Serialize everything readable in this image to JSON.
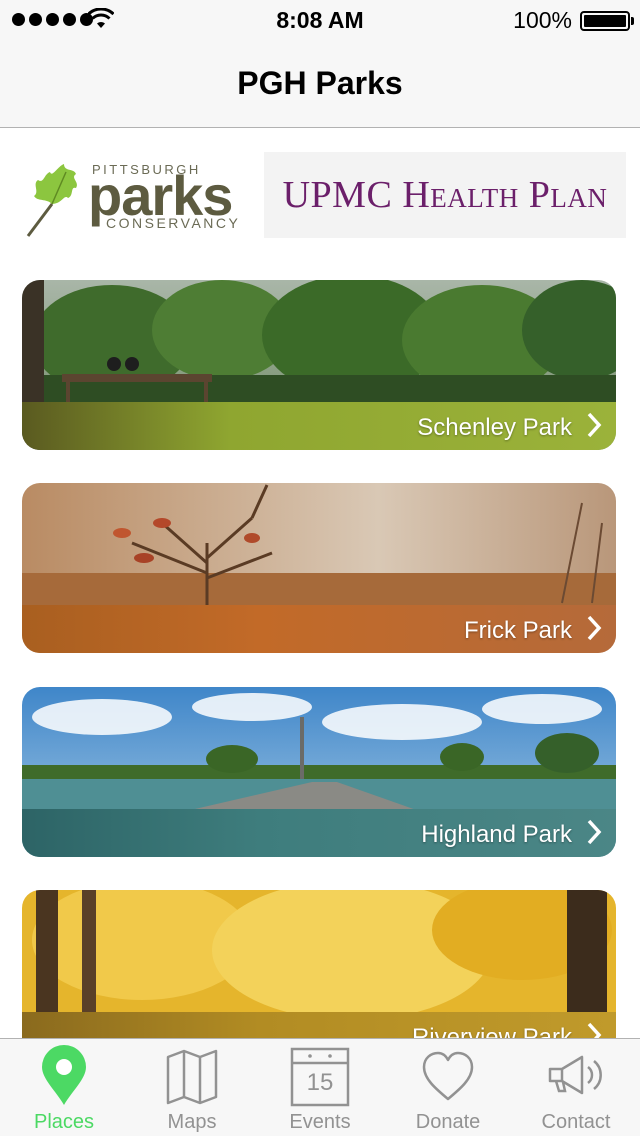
{
  "status_bar": {
    "time": "8:08 AM",
    "battery": "100%"
  },
  "nav": {
    "title": "PGH Parks"
  },
  "sponsors": {
    "conservancy": {
      "top": "PITTSBURGH",
      "main": "parks",
      "bottom": "CONSERVANCY"
    },
    "upmc": "UPMC Health Plan"
  },
  "parks": [
    {
      "name": "Schenley Park",
      "bar_color": "#8fa630"
    },
    {
      "name": "Frick Park",
      "bar_color": "#c26a28"
    },
    {
      "name": "Highland Park",
      "bar_color": "#3e7d7d"
    },
    {
      "name": "Riverview Park",
      "bar_color": "#b28c23"
    }
  ],
  "tabs": [
    {
      "label": "Places",
      "icon": "map-pin-icon",
      "active": true
    },
    {
      "label": "Maps",
      "icon": "folded-map-icon",
      "active": false
    },
    {
      "label": "Events",
      "icon": "calendar-icon",
      "calendar_day": "15",
      "active": false
    },
    {
      "label": "Donate",
      "icon": "heart-icon",
      "active": false
    },
    {
      "label": "Contact",
      "icon": "megaphone-icon",
      "active": false
    }
  ],
  "colors": {
    "accent": "#4cd964",
    "inactive": "#929292",
    "upmc_purple": "#6b1f6a",
    "leaf_green": "#8cc63f"
  }
}
